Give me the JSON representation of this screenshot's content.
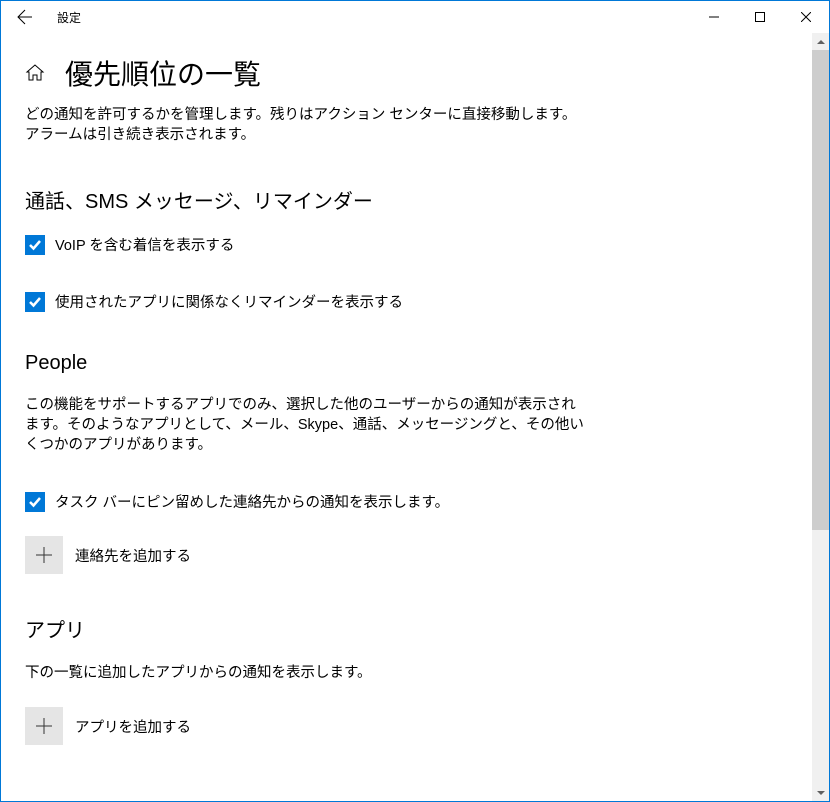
{
  "window": {
    "title": "設定"
  },
  "page": {
    "title": "優先順位の一覧",
    "description": "どの通知を許可するかを管理します。残りはアクション センターに直接移動します。アラームは引き続き表示されます。"
  },
  "sections": {
    "calls": {
      "title": "通話、SMS メッセージ、リマインダー",
      "checkbox1": {
        "label": "VoIP を含む着信を表示する",
        "checked": true
      },
      "checkbox2": {
        "label": "使用されたアプリに関係なくリマインダーを表示する",
        "checked": true
      }
    },
    "people": {
      "title": "People",
      "description": "この機能をサポートするアプリでのみ、選択した他のユーザーからの通知が表示されます。そのようなアプリとして、メール、Skype、通話、メッセージングと、その他いくつかのアプリがあります。",
      "checkbox1": {
        "label": "タスク バーにピン留めした連絡先からの通知を表示します。",
        "checked": true
      },
      "add_button": "連絡先を追加する"
    },
    "apps": {
      "title": "アプリ",
      "description": "下の一覧に追加したアプリからの通知を表示します。",
      "add_button": "アプリを追加する"
    }
  }
}
